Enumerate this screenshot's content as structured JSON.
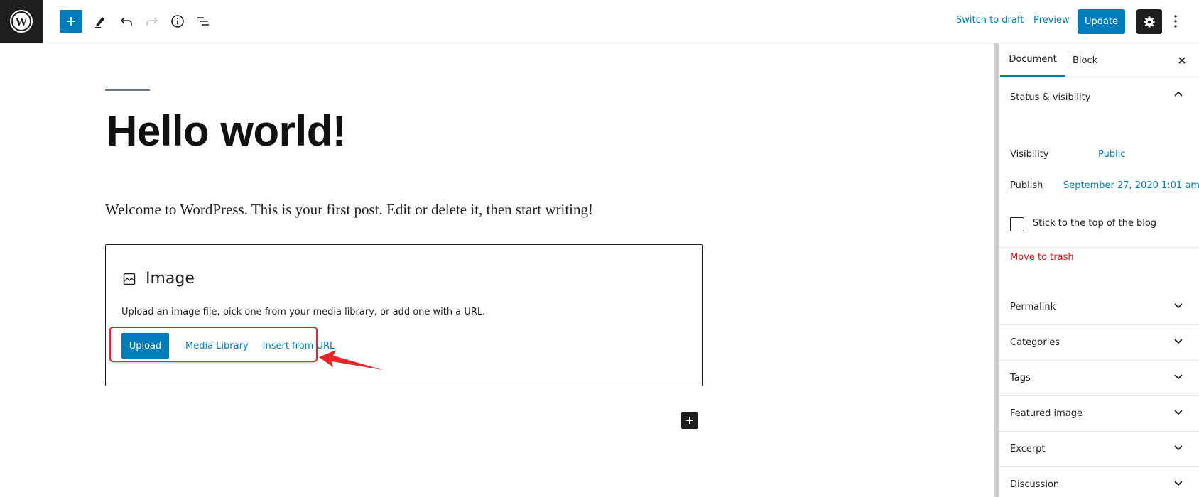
{
  "header": {
    "logo": "wordpress-logo",
    "toolbar_icons": [
      "plus-icon",
      "pencil-icon",
      "undo-icon",
      "redo-icon",
      "info-icon",
      "list-view-icon"
    ],
    "switch_to_draft": "Switch to draft",
    "preview": "Preview",
    "update": "Update",
    "accent": "#007cba"
  },
  "editor": {
    "title": "Hello world!",
    "paragraph": "Welcome to WordPress. This is your first post. Edit or delete it, then start writing!",
    "image_block": {
      "label": "Image",
      "instructions": "Upload an image file, pick one from your media library, or add one with a URL.",
      "upload": "Upload",
      "media_library": "Media Library",
      "insert_from_url": "Insert from URL"
    },
    "annotation_color": "#e8232a"
  },
  "sidebar": {
    "tabs": [
      {
        "label": "Document",
        "active": true
      },
      {
        "label": "Block",
        "active": false
      }
    ],
    "status_visibility": {
      "title": "Status & visibility",
      "visibility_label": "Visibility",
      "visibility_value": "Public",
      "publish_label": "Publish",
      "publish_value": "September 27, 2020 1:01 am",
      "sticky_label": "Stick to the top of the blog",
      "sticky_checked": false,
      "trash": "Move to trash"
    },
    "panels": [
      {
        "label": "Permalink"
      },
      {
        "label": "Categories"
      },
      {
        "label": "Tags"
      },
      {
        "label": "Featured image"
      },
      {
        "label": "Excerpt"
      },
      {
        "label": "Discussion"
      }
    ]
  }
}
